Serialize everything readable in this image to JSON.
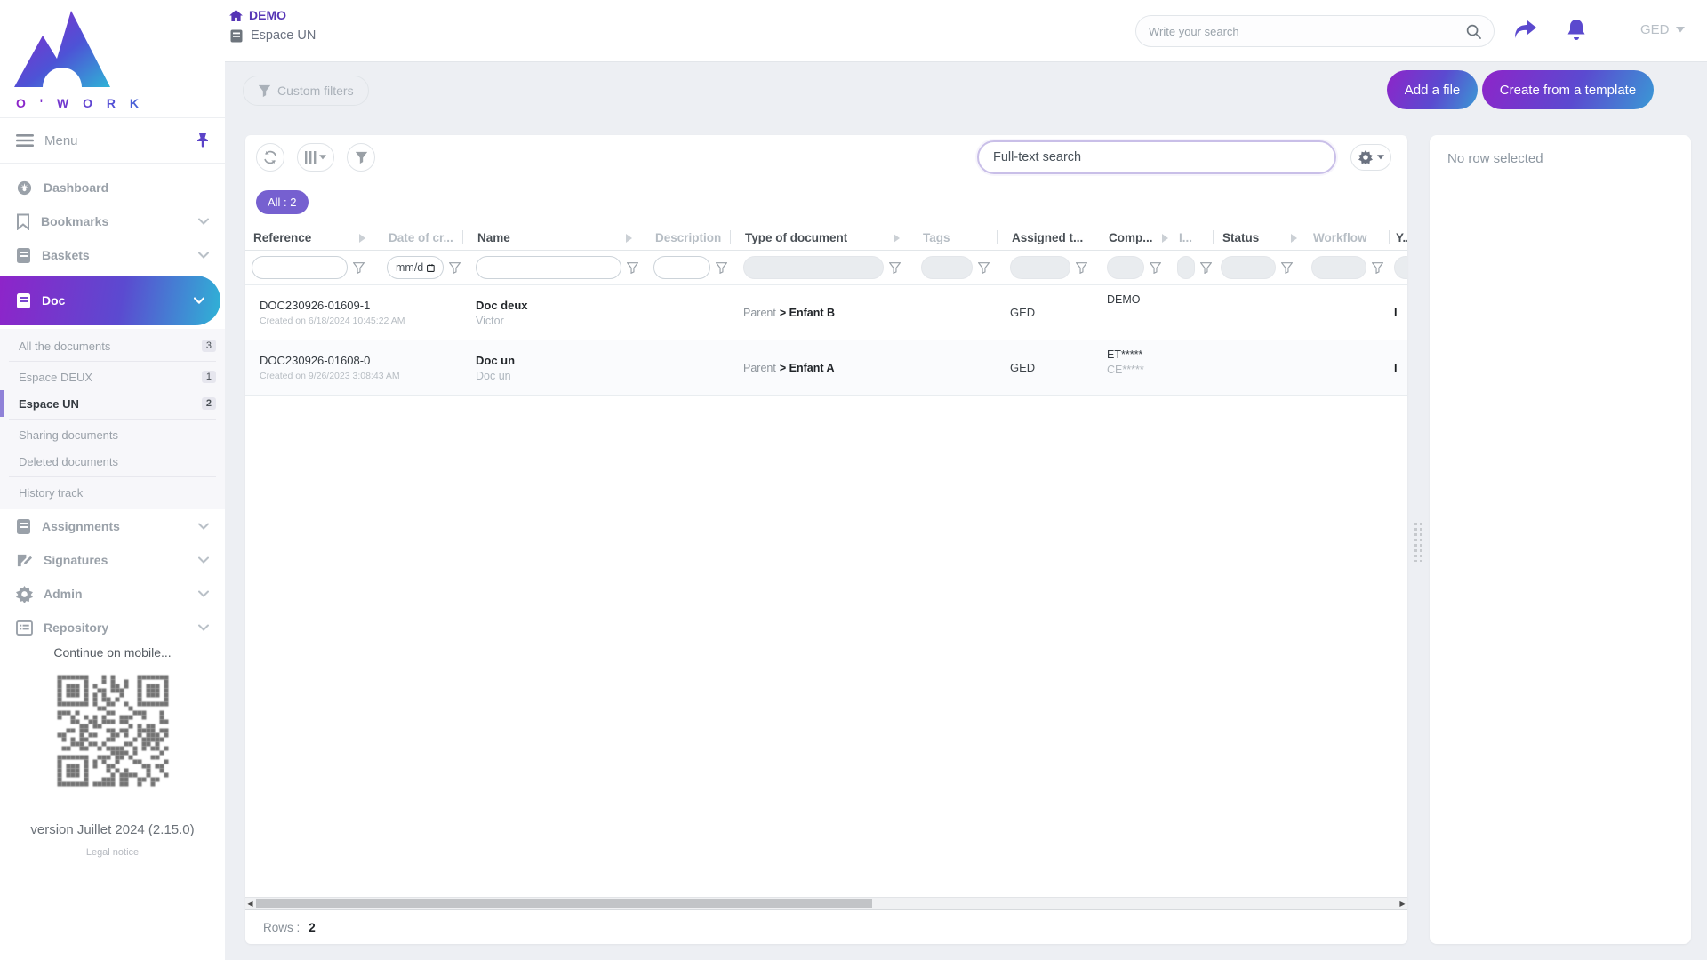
{
  "brand": {
    "name": "O ' W O R K",
    "mobile_text": "Continue on mobile...",
    "version": "version Juillet 2024 (2.15.0)",
    "legal": "Legal notice"
  },
  "topbar": {
    "home_label": "DEMO",
    "space_label": "Espace UN",
    "search_placeholder": "Write your search",
    "account_label": "GED"
  },
  "actions": {
    "custom_filters": "Custom filters",
    "add_file": "Add a file",
    "create_template": "Create from a template"
  },
  "sidebar": {
    "menu_label": "Menu",
    "items": [
      {
        "label": "Dashboard"
      },
      {
        "label": "Bookmarks"
      },
      {
        "label": "Baskets"
      },
      {
        "label": "Doc"
      }
    ],
    "doc_children": [
      {
        "label": "All the documents",
        "count": "3"
      },
      {
        "label": "Espace DEUX",
        "count": "1"
      },
      {
        "label": "Espace UN",
        "count": "2"
      },
      {
        "label": "Sharing documents",
        "count": ""
      },
      {
        "label": "Deleted documents",
        "count": ""
      },
      {
        "label": "History track",
        "count": ""
      }
    ],
    "items_lower": [
      {
        "label": "Assignments"
      },
      {
        "label": "Signatures"
      },
      {
        "label": "Admin"
      },
      {
        "label": "Repository"
      }
    ]
  },
  "grid": {
    "fulltext_placeholder": "Full-text search",
    "filter_chip": "All : 2",
    "date_filter_placeholder": "mm/d",
    "columns": [
      {
        "label": "Reference"
      },
      {
        "label": "Date of cr..."
      },
      {
        "label": "Name"
      },
      {
        "label": "Description"
      },
      {
        "label": "Type of document"
      },
      {
        "label": "Tags"
      },
      {
        "label": "Assigned t..."
      },
      {
        "label": "Comp..."
      },
      {
        "label": "I..."
      },
      {
        "label": "Status"
      },
      {
        "label": "Workflow"
      },
      {
        "label": "Y..."
      }
    ],
    "rows": [
      {
        "file_type": "word",
        "reference": "DOC230926-01609-1",
        "created": "Created on 6/18/2024 10:45:22 AM",
        "name": "Doc deux",
        "subtitle": "Victor",
        "type_parent": "Parent",
        "type_child": "> Enfant B",
        "assigned": "GED",
        "company": "DEMO",
        "company_sub": "",
        "clipped_text": "I"
      },
      {
        "file_type": "pdf",
        "reference": "DOC230926-01608-0",
        "created": "Created on 9/26/2023 3:08:43 AM",
        "name": "Doc un",
        "subtitle": "Doc un",
        "type_parent": "Parent",
        "type_child": "> Enfant A",
        "assigned": "GED",
        "company": "ET*****",
        "company_sub": "CE*****",
        "clipped_text": "I"
      }
    ],
    "rows_label": "Rows :",
    "rows_count": "2"
  },
  "detail_panel": {
    "empty_text": "No row selected"
  },
  "colors": {
    "accent_purple": "#5635b5",
    "gradient_start": "#8e24c9",
    "gradient_end": "#2fb3d6",
    "chip_purple": "#7660d0",
    "word_icon": "#2f5bb7",
    "pdf_icon": "#e8281e"
  }
}
